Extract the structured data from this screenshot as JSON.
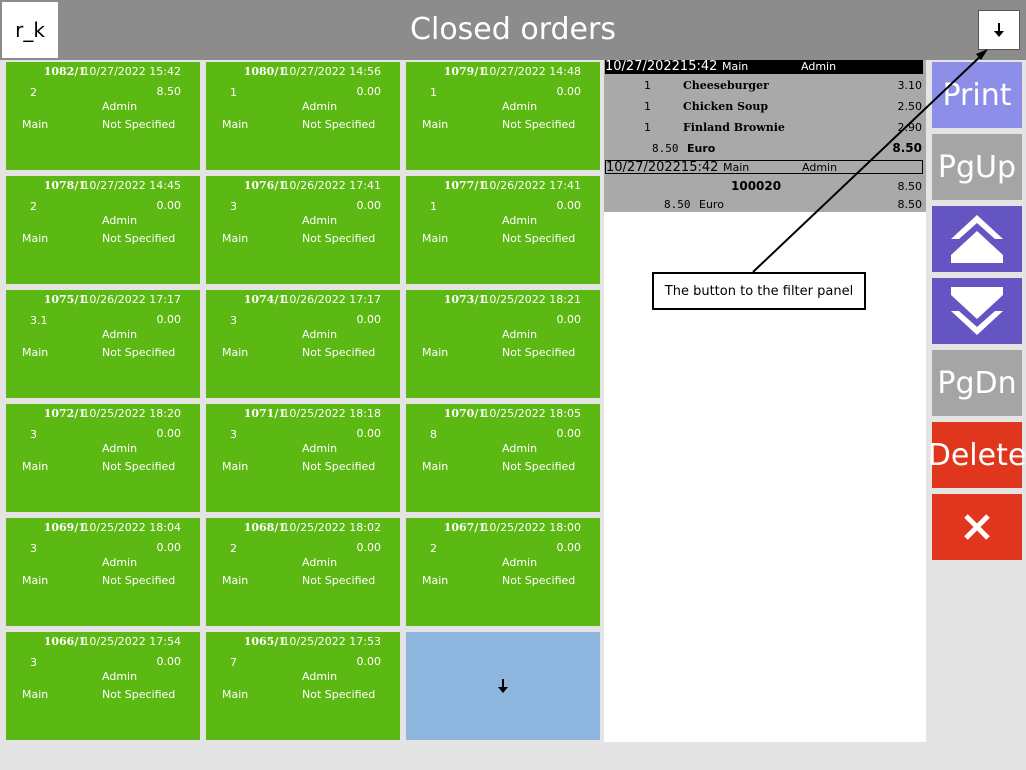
{
  "header": {
    "logo": "r_k",
    "title": "Closed orders",
    "filter_icon": "arrow-down-icon"
  },
  "orders": [
    {
      "number": "1082/1",
      "date": "10/27/2022 15:42",
      "guests": "2",
      "sum": "8.50",
      "user": "Admin",
      "hall": "Main",
      "table": "Not Specified"
    },
    {
      "number": "1080/1",
      "date": "10/27/2022 14:56",
      "guests": "1",
      "sum": "0.00",
      "user": "Admin",
      "hall": "Main",
      "table": "Not Specified"
    },
    {
      "number": "1079/1",
      "date": "10/27/2022 14:48",
      "guests": "1",
      "sum": "0.00",
      "user": "Admin",
      "hall": "Main",
      "table": "Not Specified"
    },
    {
      "number": "1078/1",
      "date": "10/27/2022 14:45",
      "guests": "2",
      "sum": "0.00",
      "user": "Admin",
      "hall": "Main",
      "table": "Not Specified"
    },
    {
      "number": "1076/1",
      "date": "10/26/2022 17:41",
      "guests": "3",
      "sum": "0.00",
      "user": "Admin",
      "hall": "Main",
      "table": "Not Specified"
    },
    {
      "number": "1077/1",
      "date": "10/26/2022 17:41",
      "guests": "1",
      "sum": "0.00",
      "user": "Admin",
      "hall": "Main",
      "table": "Not Specified"
    },
    {
      "number": "1075/1",
      "date": "10/26/2022 17:17",
      "guests": "3.1",
      "sum": "0.00",
      "user": "Admin",
      "hall": "Main",
      "table": "Not Specified"
    },
    {
      "number": "1074/1",
      "date": "10/26/2022 17:17",
      "guests": "3",
      "sum": "0.00",
      "user": "Admin",
      "hall": "Main",
      "table": "Not Specified"
    },
    {
      "number": "1073/1",
      "date": "10/25/2022 18:21",
      "guests": "",
      "sum": "0.00",
      "user": "Admin",
      "hall": "Main",
      "table": "Not Specified"
    },
    {
      "number": "1072/1",
      "date": "10/25/2022 18:20",
      "guests": "3",
      "sum": "0.00",
      "user": "Admin",
      "hall": "Main",
      "table": "Not Specified"
    },
    {
      "number": "1071/1",
      "date": "10/25/2022 18:18",
      "guests": "3",
      "sum": "0.00",
      "user": "Admin",
      "hall": "Main",
      "table": "Not Specified"
    },
    {
      "number": "1070/1",
      "date": "10/25/2022 18:05",
      "guests": "8",
      "sum": "0.00",
      "user": "Admin",
      "hall": "Main",
      "table": "Not Specified"
    },
    {
      "number": "1069/1",
      "date": "10/25/2022 18:04",
      "guests": "3",
      "sum": "0.00",
      "user": "Admin",
      "hall": "Main",
      "table": "Not Specified"
    },
    {
      "number": "1068/1",
      "date": "10/25/2022 18:02",
      "guests": "2",
      "sum": "0.00",
      "user": "Admin",
      "hall": "Main",
      "table": "Not Specified"
    },
    {
      "number": "1067/1",
      "date": "10/25/2022 18:00",
      "guests": "2",
      "sum": "0.00",
      "user": "Admin",
      "hall": "Main",
      "table": "Not Specified"
    },
    {
      "number": "1066/1",
      "date": "10/25/2022 17:54",
      "guests": "3",
      "sum": "0.00",
      "user": "Admin",
      "hall": "Main",
      "table": "Not Specified"
    },
    {
      "number": "1065/1",
      "date": "10/25/2022 17:53",
      "guests": "7",
      "sum": "0.00",
      "user": "Admin",
      "hall": "Main",
      "table": "Not Specified"
    }
  ],
  "more_icon": "arrow-down-icon",
  "receipt": {
    "header": {
      "datetime": "10/27/202215:42",
      "hall": "Main",
      "user": "Admin"
    },
    "items": [
      {
        "qty": "1",
        "name": "Cheeseburger",
        "price": "3.10"
      },
      {
        "qty": "1",
        "name": "Chicken Soup",
        "price": "2.50"
      },
      {
        "qty": "1",
        "name": "Finland Brownie",
        "price": "2.90"
      }
    ],
    "total": {
      "amount": "8.50",
      "currency": "Euro",
      "value": "8.50"
    },
    "payment_header": {
      "datetime": "10/27/202215:42",
      "hall": "Main",
      "user": "Admin"
    },
    "payment": {
      "code": "100020",
      "value": "8.50"
    },
    "paid": {
      "amount": "8.50",
      "currency": "Euro",
      "value": "8.50"
    }
  },
  "buttons": {
    "print": "Print",
    "pgup": "PgUp",
    "pgdn": "PgDn",
    "delete": "Delete",
    "up_icon": "double-chevron-up-icon",
    "down_icon": "double-chevron-down-icon",
    "close_icon": "close-icon"
  },
  "annotation": {
    "text": "The button to the filter panel"
  }
}
